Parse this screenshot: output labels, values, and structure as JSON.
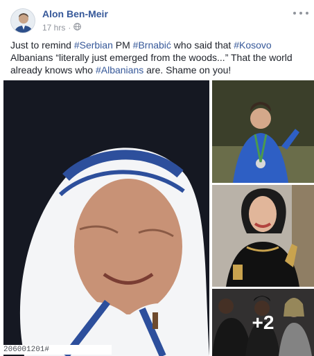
{
  "post": {
    "author": "Alon Ben-Meir",
    "time": "17 hrs",
    "privacy_icon": "globe-icon",
    "more_icon": "ellipsis-icon",
    "text_segments": [
      {
        "text": "Just to remind ",
        "tag": false
      },
      {
        "text": "#Serbian",
        "tag": true
      },
      {
        "text": " PM ",
        "tag": false
      },
      {
        "text": "#Brnabić",
        "tag": true
      },
      {
        "text": " who said that ",
        "tag": false
      },
      {
        "text": "#Kosovo",
        "tag": true
      },
      {
        "text": " Albanians “literally just emerged from the woods...” That the world already knows who ",
        "tag": false
      },
      {
        "text": "#Albanians",
        "tag": true
      },
      {
        "text": " are. Shame on you!",
        "tag": false
      }
    ]
  },
  "media": {
    "main_photo_id": "206001201#",
    "extra_count": "+2"
  },
  "colors": {
    "link": "#365899",
    "meta": "#90949c",
    "text": "#1d2129"
  }
}
